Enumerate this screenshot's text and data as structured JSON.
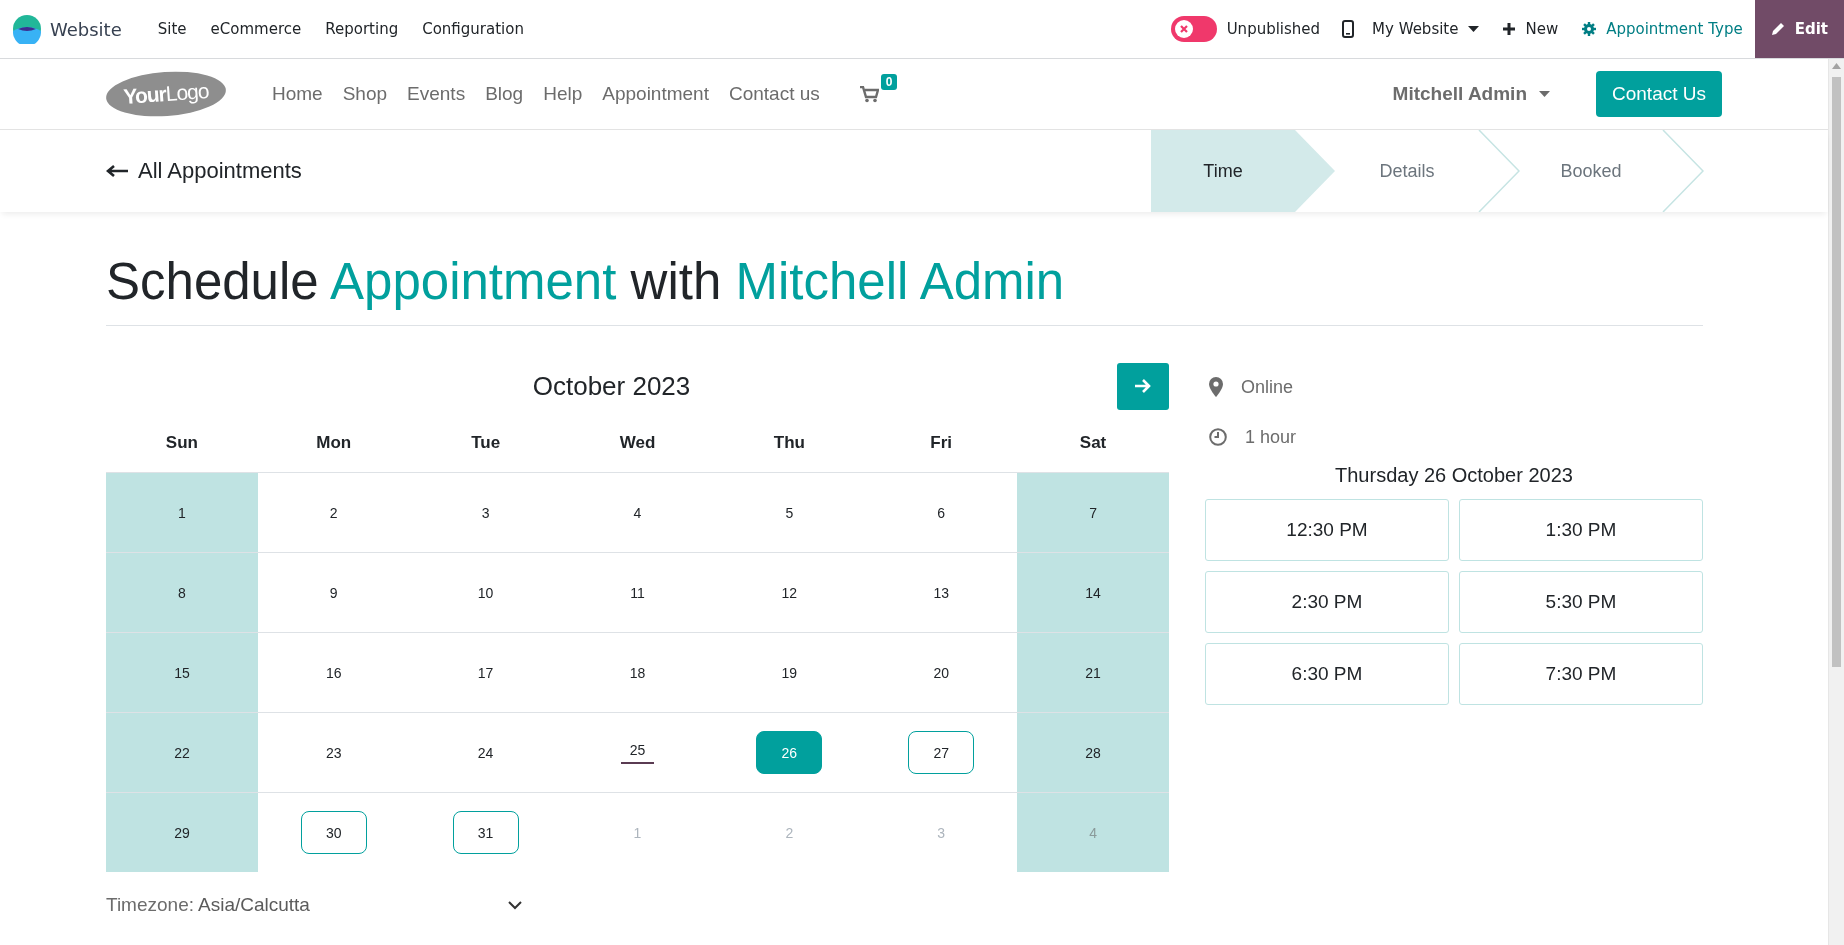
{
  "topbar": {
    "app_name": "Website",
    "menus": [
      "Site",
      "eCommerce",
      "Reporting",
      "Configuration"
    ],
    "publish_toggle": {
      "label": "Unpublished",
      "on": false
    },
    "website_switcher": "My Website",
    "new_label": "New",
    "appointment_type": "Appointment Type",
    "edit": "Edit"
  },
  "site_nav": {
    "logo": "**Your**Logo",
    "items": [
      "Home",
      "Shop",
      "Events",
      "Blog",
      "Help",
      "Appointment",
      "Contact us"
    ],
    "cart_count": "0",
    "user": "Mitchell Admin",
    "contact_button": "Contact Us"
  },
  "back_link": "All Appointments",
  "steps": [
    {
      "label": "Time",
      "selected": true
    },
    {
      "label": "Details",
      "selected": false
    },
    {
      "label": "Booked",
      "selected": false
    }
  ],
  "heading": [
    {
      "text": "Schedule",
      "highlight": false
    },
    {
      "text": "Appointment",
      "highlight": true
    },
    {
      "text": "with",
      "highlight": false
    },
    {
      "text": "Mitchell Admin",
      "highlight": true
    }
  ],
  "calendar": {
    "month": "October 2023",
    "weekdays": [
      "Sun",
      "Mon",
      "Tue",
      "Wed",
      "Thu",
      "Fri",
      "Sat"
    ],
    "weeks": [
      [
        {
          "label": "1",
          "weekend": true,
          "outside": false,
          "today": false,
          "available": false,
          "selected": false
        },
        {
          "label": "2",
          "weekend": false,
          "outside": false,
          "today": false,
          "available": false,
          "selected": false
        },
        {
          "label": "3",
          "weekend": false,
          "outside": false,
          "today": false,
          "available": false,
          "selected": false
        },
        {
          "label": "4",
          "weekend": false,
          "outside": false,
          "today": false,
          "available": false,
          "selected": false
        },
        {
          "label": "5",
          "weekend": false,
          "outside": false,
          "today": false,
          "available": false,
          "selected": false
        },
        {
          "label": "6",
          "weekend": false,
          "outside": false,
          "today": false,
          "available": false,
          "selected": false
        },
        {
          "label": "7",
          "weekend": true,
          "outside": false,
          "today": false,
          "available": false,
          "selected": false
        }
      ],
      [
        {
          "label": "8",
          "weekend": true,
          "outside": false,
          "today": false,
          "available": false,
          "selected": false
        },
        {
          "label": "9",
          "weekend": false,
          "outside": false,
          "today": false,
          "available": false,
          "selected": false
        },
        {
          "label": "10",
          "weekend": false,
          "outside": false,
          "today": false,
          "available": false,
          "selected": false
        },
        {
          "label": "11",
          "weekend": false,
          "outside": false,
          "today": false,
          "available": false,
          "selected": false
        },
        {
          "label": "12",
          "weekend": false,
          "outside": false,
          "today": false,
          "available": false,
          "selected": false
        },
        {
          "label": "13",
          "weekend": false,
          "outside": false,
          "today": false,
          "available": false,
          "selected": false
        },
        {
          "label": "14",
          "weekend": true,
          "outside": false,
          "today": false,
          "available": false,
          "selected": false
        }
      ],
      [
        {
          "label": "15",
          "weekend": true,
          "outside": false,
          "today": false,
          "available": false,
          "selected": false
        },
        {
          "label": "16",
          "weekend": false,
          "outside": false,
          "today": false,
          "available": false,
          "selected": false
        },
        {
          "label": "17",
          "weekend": false,
          "outside": false,
          "today": false,
          "available": false,
          "selected": false
        },
        {
          "label": "18",
          "weekend": false,
          "outside": false,
          "today": false,
          "available": false,
          "selected": false
        },
        {
          "label": "19",
          "weekend": false,
          "outside": false,
          "today": false,
          "available": false,
          "selected": false
        },
        {
          "label": "20",
          "weekend": false,
          "outside": false,
          "today": false,
          "available": false,
          "selected": false
        },
        {
          "label": "21",
          "weekend": true,
          "outside": false,
          "today": false,
          "available": false,
          "selected": false
        }
      ],
      [
        {
          "label": "22",
          "weekend": true,
          "outside": false,
          "today": false,
          "available": false,
          "selected": false
        },
        {
          "label": "23",
          "weekend": false,
          "outside": false,
          "today": false,
          "available": false,
          "selected": false
        },
        {
          "label": "24",
          "weekend": false,
          "outside": false,
          "today": false,
          "available": false,
          "selected": false
        },
        {
          "label": "25",
          "weekend": false,
          "outside": false,
          "today": true,
          "available": false,
          "selected": false
        },
        {
          "label": "26",
          "weekend": false,
          "outside": false,
          "today": false,
          "available": true,
          "selected": true
        },
        {
          "label": "27",
          "weekend": false,
          "outside": false,
          "today": false,
          "available": true,
          "selected": false
        },
        {
          "label": "28",
          "weekend": true,
          "outside": false,
          "today": false,
          "available": false,
          "selected": false
        }
      ],
      [
        {
          "label": "29",
          "weekend": true,
          "outside": false,
          "today": false,
          "available": false,
          "selected": false
        },
        {
          "label": "30",
          "weekend": false,
          "outside": false,
          "today": false,
          "available": true,
          "selected": false
        },
        {
          "label": "31",
          "weekend": false,
          "outside": false,
          "today": false,
          "available": true,
          "selected": false
        },
        {
          "label": "1",
          "weekend": false,
          "outside": true,
          "today": false,
          "available": false,
          "selected": false
        },
        {
          "label": "2",
          "weekend": false,
          "outside": true,
          "today": false,
          "available": false,
          "selected": false
        },
        {
          "label": "3",
          "weekend": false,
          "outside": true,
          "today": false,
          "available": false,
          "selected": false
        },
        {
          "label": "4",
          "weekend": true,
          "outside": true,
          "today": false,
          "available": false,
          "selected": false
        }
      ]
    ]
  },
  "timezone": {
    "label": "Timezone:",
    "value": "Asia/Calcutta"
  },
  "details": {
    "location": "Online",
    "duration": "1 hour",
    "date_title": "Thursday 26 October 2023",
    "slots": [
      "12:30 PM",
      "1:30 PM",
      "2:30 PM",
      "5:30 PM",
      "6:30 PM",
      "7:30 PM"
    ]
  }
}
